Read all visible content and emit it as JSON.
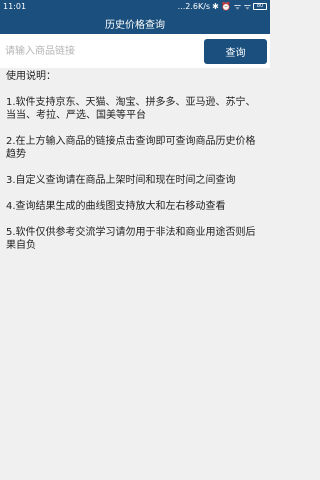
{
  "status": {
    "time": "11:01",
    "speed": "...2.6K/s",
    "icons": "✱ ⏰ ᯤ ᯤ",
    "battery": "80"
  },
  "header": {
    "title": "历史价格查询"
  },
  "search": {
    "placeholder": "请输入商品链接",
    "value": "",
    "button_label": "查询"
  },
  "instructions": {
    "title": "使用说明：",
    "items": [
      "1.软件支持京东、天猫、淘宝、拼多多、亚马逊、苏宁、当当、考拉、严选、国美等平台",
      "2.在上方输入商品的链接点击查询即可查询商品历史价格趋势",
      "3.自定义查询请在商品上架时间和现在时间之间查询",
      "4.查询结果生成的曲线图支持放大和左右移动查看",
      "5.软件仅供参考交流学习请勿用于非法和商业用途否则后果自负"
    ]
  },
  "colors": {
    "brand": "#1b4f7d",
    "background": "#f0f0f0"
  }
}
